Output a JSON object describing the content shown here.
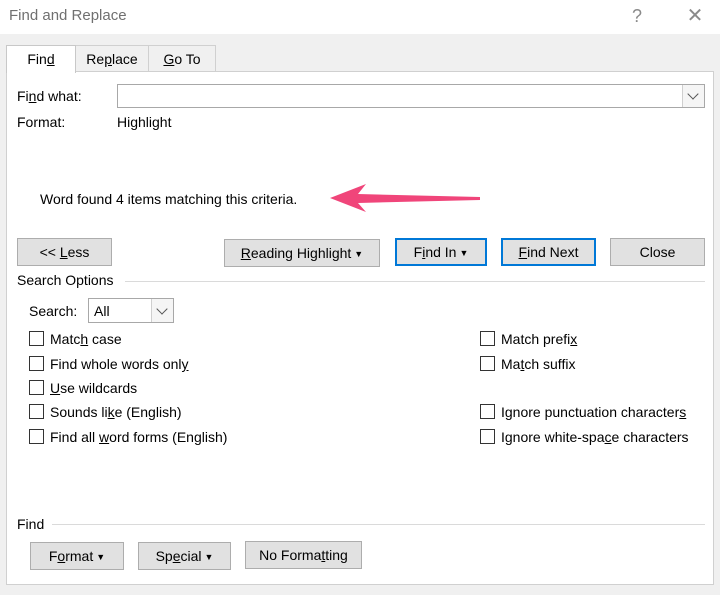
{
  "window": {
    "title": "Find and Replace",
    "help_glyph": "?",
    "close_glyph": "✕"
  },
  "tabs": [
    {
      "pre": "Fin",
      "key": "d",
      "post": ""
    },
    {
      "pre": "Re",
      "key": "p",
      "post": "lace"
    },
    {
      "pre": "",
      "key": "G",
      "post": "o To"
    }
  ],
  "find": {
    "label_pre": "Fi",
    "label_key": "n",
    "label_post": "d what:",
    "value": "",
    "format_label": "Format:",
    "format_value": "Highlight"
  },
  "result_message": "Word found 4 items matching this criteria.",
  "annotation_color": "#f0457a",
  "buttons": {
    "less": {
      "pre": "<< ",
      "key": "L",
      "post": "ess"
    },
    "reading_highlight": {
      "pre": "",
      "key": "R",
      "post": "eading Highlight"
    },
    "find_in": {
      "pre": "F",
      "key": "i",
      "post": "nd In"
    },
    "find_next": {
      "pre": "",
      "key": "F",
      "post": "ind Next"
    },
    "close": "Close"
  },
  "search_options": {
    "heading": "Search Options",
    "search_label_pre": "Search",
    "search_label_key": "",
    "search_label_post": ":",
    "search_value": "All",
    "left": [
      {
        "pre": "Matc",
        "key": "h",
        "post": " case",
        "checked": false
      },
      {
        "pre": "Find whole words onl",
        "key": "y",
        "post": "",
        "checked": false
      },
      {
        "pre": "",
        "key": "U",
        "post": "se wildcards",
        "checked": false
      },
      {
        "pre": "Sounds li",
        "key": "k",
        "post": "e (English)",
        "checked": false
      },
      {
        "pre": "Find all ",
        "key": "w",
        "post": "ord forms (English)",
        "checked": false
      }
    ],
    "right": [
      {
        "pre": "Match prefi",
        "key": "x",
        "post": "",
        "checked": false
      },
      {
        "pre": "Ma",
        "key": "t",
        "post": "ch suffix",
        "checked": false
      },
      {
        "pre": "Ignore punctuation character",
        "key": "s",
        "post": "",
        "checked": false
      },
      {
        "pre": "Ignore white-spa",
        "key": "c",
        "post": "e characters",
        "checked": false
      }
    ]
  },
  "find_group": {
    "heading": "Find",
    "format": {
      "pre": "F",
      "key": "o",
      "post": "rmat"
    },
    "special": {
      "pre": "Sp",
      "key": "e",
      "post": "cial"
    },
    "no_formatting": {
      "pre": "No Forma",
      "key": "t",
      "post": "ting"
    }
  }
}
